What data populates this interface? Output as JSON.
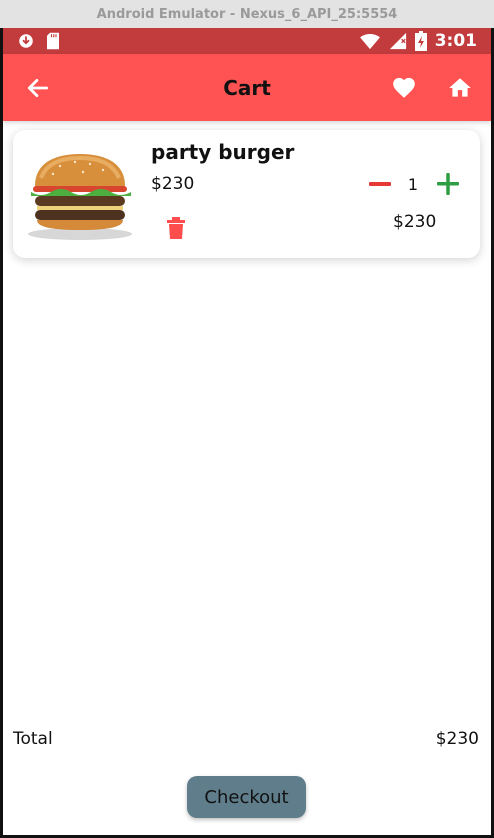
{
  "window": {
    "title": "Android Emulator - Nexus_6_API_25:5554"
  },
  "status_bar": {
    "time": "3:01",
    "icons": [
      "download-icon",
      "sd-card-icon",
      "wifi-icon",
      "signal-icon",
      "battery-charging-icon"
    ]
  },
  "app_bar": {
    "title": "Cart",
    "background": "#ff5252",
    "icons": [
      "back-arrow-icon",
      "heart-icon",
      "home-icon"
    ]
  },
  "cart": {
    "items": [
      {
        "name": "party burger",
        "price": "$230",
        "quantity": "1",
        "line_total": "$230"
      }
    ]
  },
  "summary": {
    "total_label": "Total",
    "total_value": "$230"
  },
  "checkout": {
    "label": "Checkout",
    "color": "#5f7d8b"
  },
  "colors": {
    "status_bar": "#c23b3d",
    "minus": "#e53935",
    "plus": "#2e9e44",
    "delete": "#ff4d4d"
  }
}
